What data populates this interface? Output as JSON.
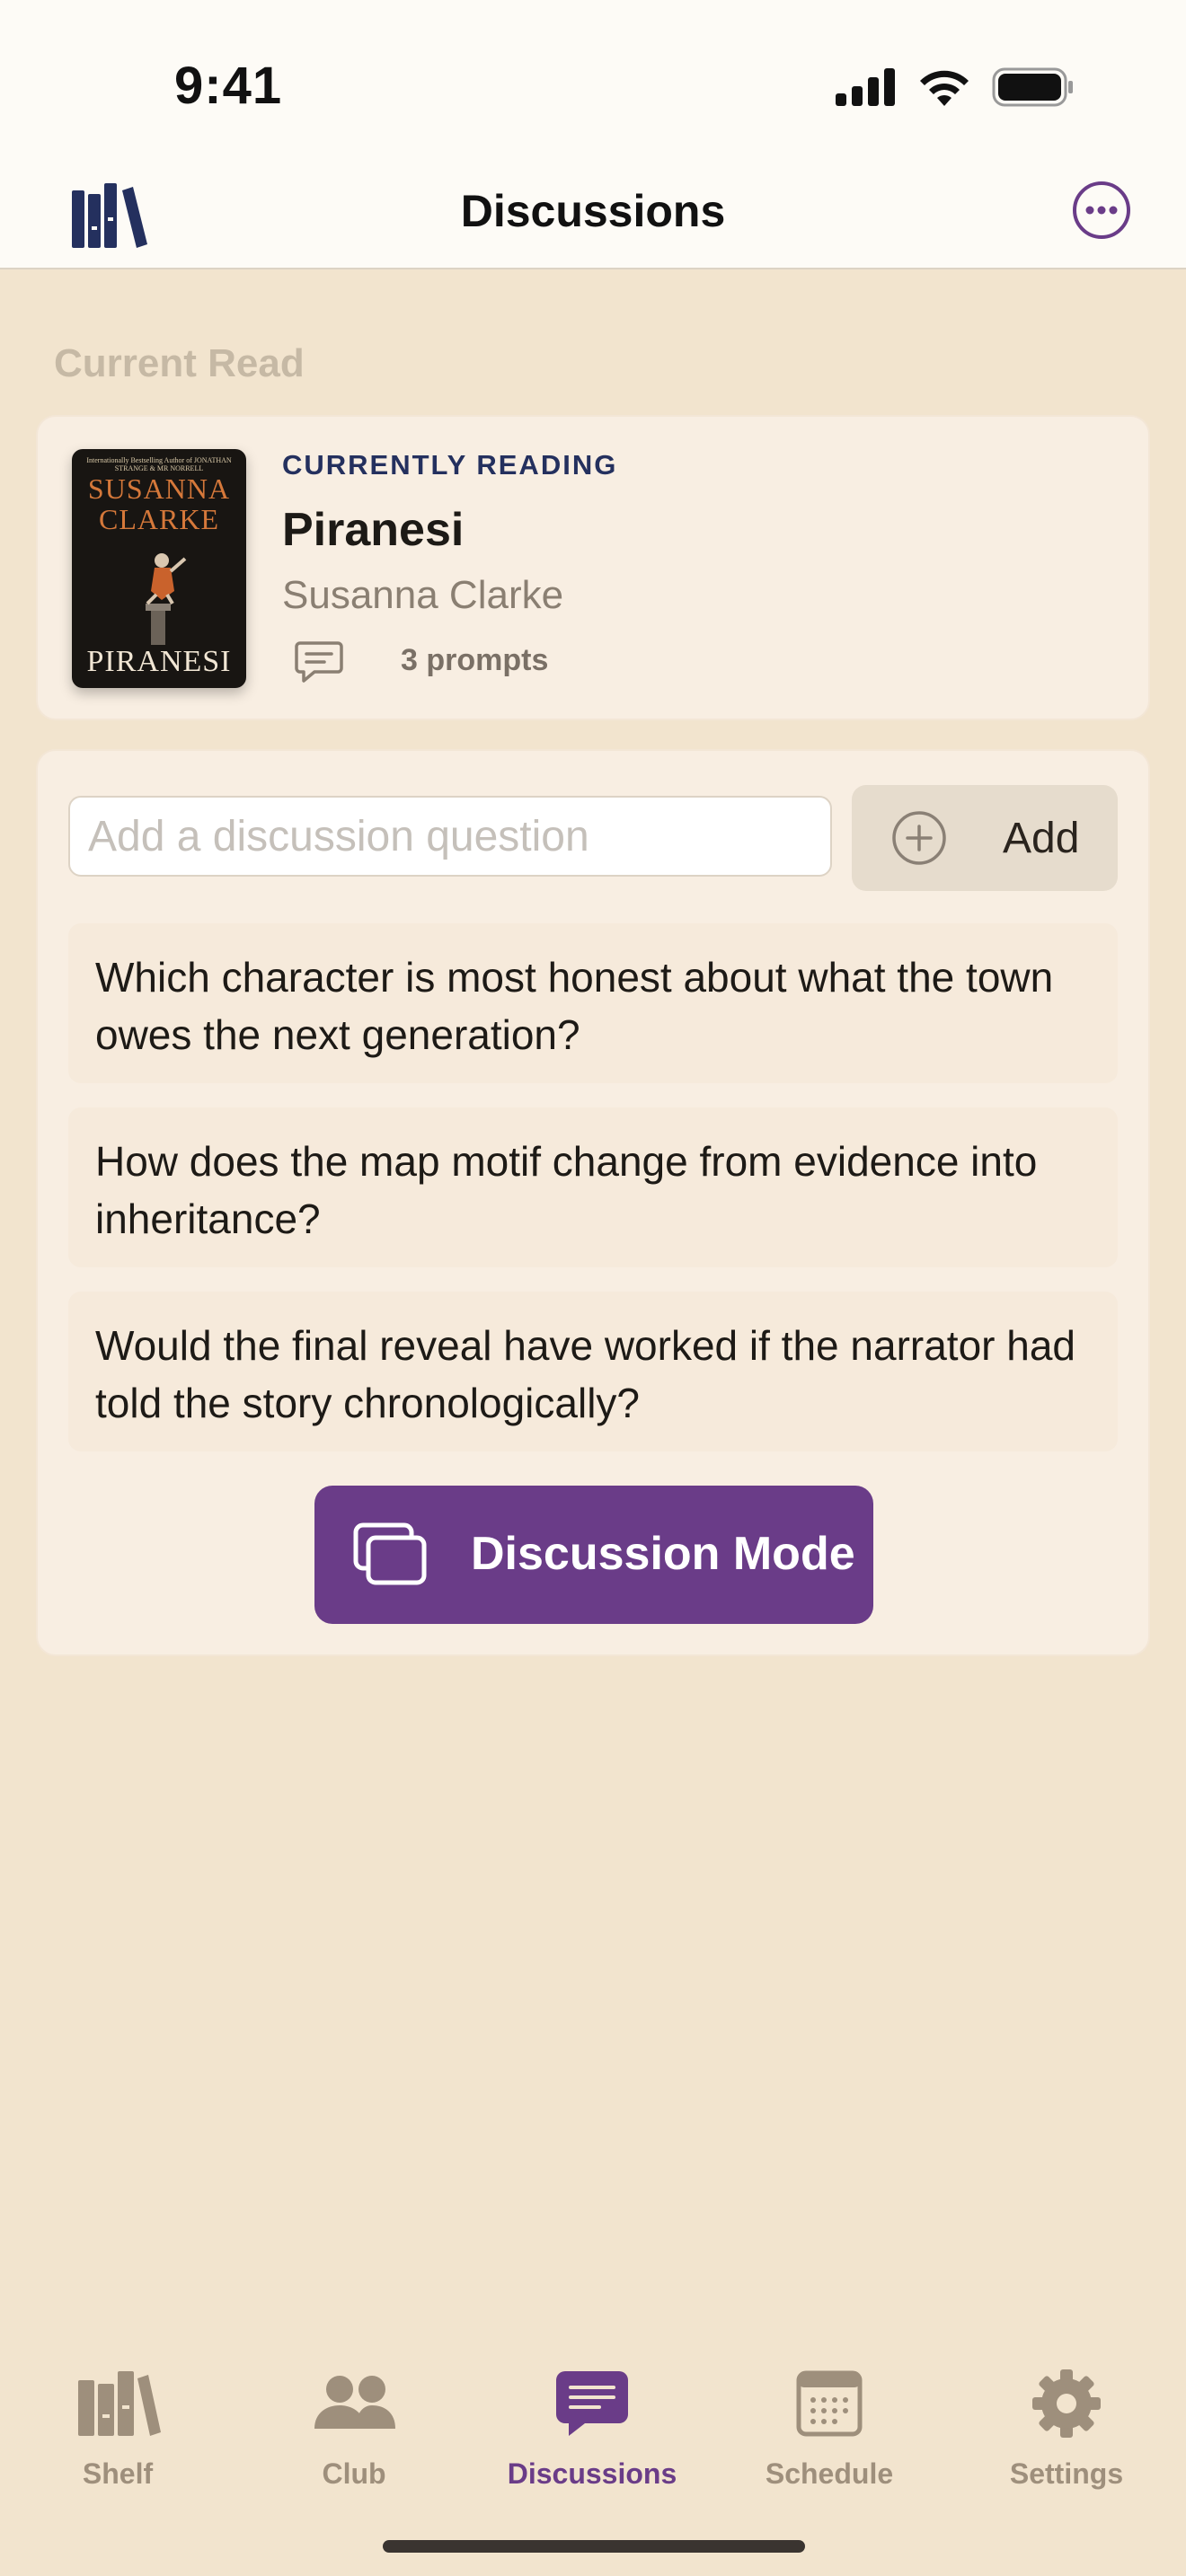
{
  "status_bar": {
    "time": "9:41"
  },
  "nav": {
    "title": "Discussions"
  },
  "section": {
    "label": "Current Read"
  },
  "book": {
    "eyebrow": "CURRENTLY READING",
    "title": "Piranesi",
    "author": "Susanna Clarke",
    "prompt_count": "3 prompts",
    "cover": {
      "small_text": "Internationally Bestselling Author of JONATHAN STRANGE & MR NORRELL",
      "author_line1": "SUSANNA",
      "author_line2": "CLARKE",
      "title": "PIRANESI"
    }
  },
  "discussion": {
    "input_placeholder": "Add a discussion question",
    "input_value": "",
    "add_label": "Add",
    "questions": [
      "Which character is most honest about what the town owes the next generation?",
      "How does the map motif change from evidence into inheritance?",
      "Would the final reveal have worked if the narrator had told the story chronologically?"
    ],
    "mode_button_label": "Discussion Mode"
  },
  "tabs": [
    {
      "label": "Shelf",
      "icon": "bookshelf-icon",
      "active": false
    },
    {
      "label": "Club",
      "icon": "people-icon",
      "active": false
    },
    {
      "label": "Discussions",
      "icon": "chat-bubble-icon",
      "active": true
    },
    {
      "label": "Schedule",
      "icon": "calendar-icon",
      "active": false
    },
    {
      "label": "Settings",
      "icon": "gear-icon",
      "active": false
    }
  ],
  "colors": {
    "accent": "#6A3C88",
    "brand_navy": "#24305E",
    "background": "#F2E4CE",
    "tab_inactive": "#9E8F7C"
  }
}
